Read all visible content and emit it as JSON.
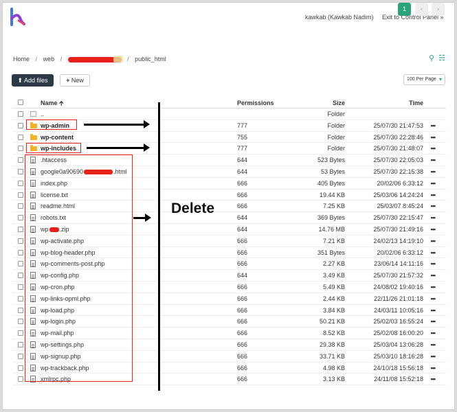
{
  "header": {
    "user": "kawkab (Kawkab Nadim)",
    "exit": "Exit to Control Panel »",
    "accent": "#2aa37a"
  },
  "breadcrumb": {
    "home": "Home",
    "web": "web",
    "redacted_icon": "redacted-segment",
    "current": "public_html"
  },
  "toolbar": {
    "add_files": "Add files",
    "new": "New",
    "per_page": "100 Per Page"
  },
  "table": {
    "columns": {
      "name": "Name",
      "permissions": "Permissions",
      "size": "Size",
      "time": "Time"
    },
    "up": {
      "name": "..",
      "size": "Folder"
    },
    "rows": [
      {
        "name": "wp-admin",
        "type": "folder",
        "perm": "777",
        "size": "Folder",
        "time": "25/07/30 21:47:53"
      },
      {
        "name": "wp-content",
        "type": "folder",
        "perm": "755",
        "size": "Folder",
        "time": "25/07/30 22:28:46"
      },
      {
        "name": "wp-includes",
        "type": "folder",
        "perm": "777",
        "size": "Folder",
        "time": "25/07/30 21:48:07"
      },
      {
        "name": ".htaccess",
        "type": "file",
        "perm": "644",
        "size": "523 Bytes",
        "time": "25/07/30 22:05:03"
      },
      {
        "name_pre": "google0a90690",
        "name_post": ".html",
        "type": "file",
        "perm": "644",
        "size": "53 Bytes",
        "time": "25/07/30 22:15:38"
      },
      {
        "name": "index.php",
        "type": "file",
        "perm": "666",
        "size": "405 Bytes",
        "time": "20/02/06 6:33:12"
      },
      {
        "name": "license.txt",
        "type": "file",
        "perm": "666",
        "size": "19.44 KB",
        "time": "25/03/06 14:24:24"
      },
      {
        "name": "readme.html",
        "type": "file",
        "perm": "666",
        "size": "7.25 KB",
        "time": "25/03/07 8:45:24"
      },
      {
        "name": "robots.txt",
        "type": "file",
        "perm": "644",
        "size": "369 Bytes",
        "time": "25/07/30 22:15:47"
      },
      {
        "name_pre": "wp",
        "name_post": ".zip",
        "type": "file",
        "perm": "644",
        "size": "14.76 MB",
        "time": "25/07/30 21:49:16"
      },
      {
        "name": "wp-activate.php",
        "type": "file",
        "perm": "666",
        "size": "7.21 KB",
        "time": "24/02/13 14:19:10"
      },
      {
        "name": "wp-blog-header.php",
        "type": "file",
        "perm": "666",
        "size": "351 Bytes",
        "time": "20/02/06 6:33:12"
      },
      {
        "name": "wp-comments-post.php",
        "type": "file",
        "perm": "666",
        "size": "2.27 KB",
        "time": "23/06/14 14:11:16"
      },
      {
        "name": "wp-config.php",
        "type": "file",
        "perm": "644",
        "size": "3.49 KB",
        "time": "25/07/30 21:57:32"
      },
      {
        "name": "wp-cron.php",
        "type": "file",
        "perm": "666",
        "size": "5.49 KB",
        "time": "24/08/02 19:40:16"
      },
      {
        "name": "wp-links-opml.php",
        "type": "file",
        "perm": "666",
        "size": "2.44 KB",
        "time": "22/11/26 21:01:18"
      },
      {
        "name": "wp-load.php",
        "type": "file",
        "perm": "666",
        "size": "3.84 KB",
        "time": "24/03/11 10:05:16"
      },
      {
        "name": "wp-login.php",
        "type": "file",
        "perm": "666",
        "size": "50.21 KB",
        "time": "25/02/03 16:55:24"
      },
      {
        "name": "wp-mail.php",
        "type": "file",
        "perm": "666",
        "size": "8.52 KB",
        "time": "25/02/08 16:00:20"
      },
      {
        "name": "wp-settings.php",
        "type": "file",
        "perm": "666",
        "size": "29.38 KB",
        "time": "25/03/04 13:06:28"
      },
      {
        "name": "wp-signup.php",
        "type": "file",
        "perm": "666",
        "size": "33.71 KB",
        "time": "25/03/10 18:16:28"
      },
      {
        "name": "wp-trackback.php",
        "type": "file",
        "perm": "666",
        "size": "4.98 KB",
        "time": "24/10/18 15:56:18"
      },
      {
        "name": "xmlrpc.php",
        "type": "file",
        "perm": "666",
        "size": "3.13 KB",
        "time": "24/11/08 15:52:18"
      }
    ],
    "more": "•••"
  },
  "annotation": {
    "label": "Delete",
    "color": "#e8201a"
  },
  "pager": {
    "current": "1",
    "prev": "‹",
    "next": "›"
  }
}
